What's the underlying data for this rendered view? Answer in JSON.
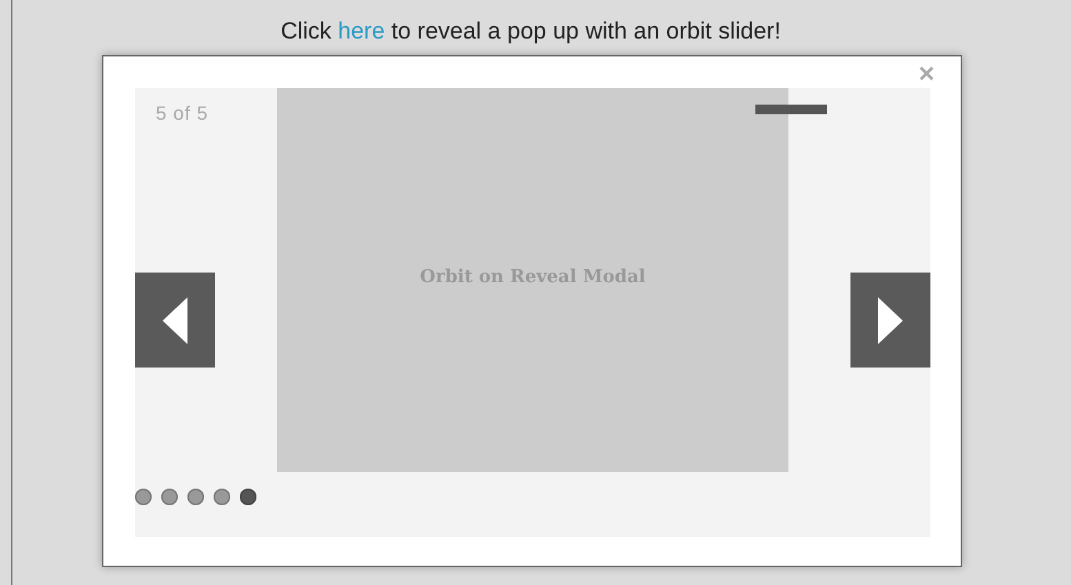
{
  "intro": {
    "before": "Click ",
    "link": "here",
    "after": " to reveal a pop up with an orbit slider!"
  },
  "modal": {
    "close": "×",
    "slider": {
      "counter": "5 of 5",
      "caption": "Orbit on Reveal Modal",
      "timer": {
        "level": 0
      },
      "bullets": [
        {
          "selected": false
        },
        {
          "selected": false
        },
        {
          "selected": false
        },
        {
          "selected": false
        },
        {
          "selected": true
        }
      ]
    }
  }
}
